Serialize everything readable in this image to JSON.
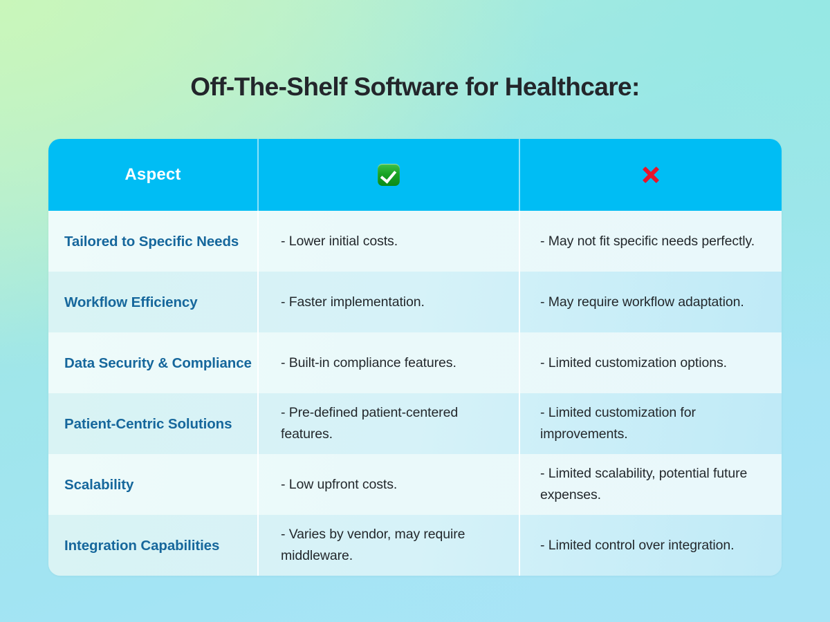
{
  "title": "Off-The-Shelf Software for Healthcare:",
  "colors": {
    "header_bg": "#00bdf4",
    "aspect_text": "#16679c",
    "body_text": "#23282c",
    "title_text": "#23262b",
    "row_odd_bg": "#eefbfa",
    "row_even_bg": "#d9f3f4",
    "check_green": "#1aa425",
    "cross_red": "#e8142a",
    "bg_top_left": "#c9f6ba",
    "bg_top_right": "#96e8e4",
    "bg_bottom_left": "#a5e8f5",
    "bg_bottom_right": "#a8e4f5"
  },
  "table": {
    "headers": {
      "aspect": "Aspect",
      "pros_icon": "white-heavy-check-mark-icon",
      "cons_icon": "cross-mark-icon"
    },
    "rows": [
      {
        "aspect": "Tailored to Specific Needs",
        "pro": "- Lower initial costs.",
        "con": "- May not fit specific needs perfectly."
      },
      {
        "aspect": "Workflow Efficiency",
        "pro": "- Faster implementation.",
        "con": "- May require workflow adaptation."
      },
      {
        "aspect": "Data Security & Compliance",
        "pro": "- Built-in compliance features.",
        "con": "- Limited customization options."
      },
      {
        "aspect": "Patient-Centric Solutions",
        "pro": "- Pre-defined patient-centered features.",
        "con": "- Limited customization for improvements."
      },
      {
        "aspect": "Scalability",
        "pro": "- Low upfront costs.",
        "con": "- Limited scalability, potential future expenses."
      },
      {
        "aspect": "Integration Capabilities",
        "pro": "- Varies by vendor, may require middleware.",
        "con": "- Limited control over integration."
      }
    ]
  }
}
